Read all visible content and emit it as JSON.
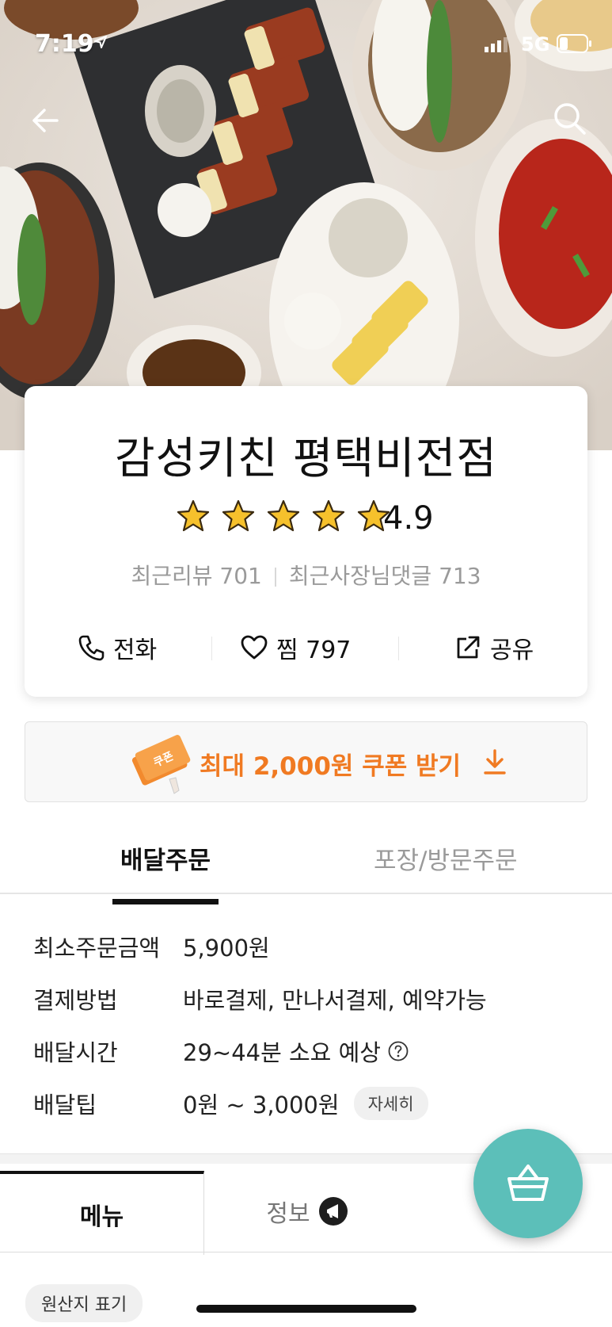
{
  "status_bar": {
    "time": "7:19",
    "network": "5G"
  },
  "store": {
    "name": "감성키친 평택비전점",
    "rating": "4.9",
    "stars_filled": 5,
    "recent_reviews": "최근리뷰 701",
    "owner_replies": "최근사장님댓글 713"
  },
  "actions": {
    "call": "전화",
    "favorite": "찜 797",
    "share": "공유"
  },
  "coupon": {
    "label": "최대 2,000원 쿠폰 받기",
    "ticket_text": "쿠폰"
  },
  "order_tabs": {
    "delivery": "배달주문",
    "pickup": "포장/방문주문"
  },
  "info": {
    "min_order_key": "최소주문금액",
    "min_order_val": "5,900원",
    "payment_key": "결제방법",
    "payment_val": "바로결제, 만나서결제, 예약가능",
    "time_key": "배달시간",
    "time_val": "29~44분 소요 예상",
    "tip_key": "배달팁",
    "tip_val": "0원 ~ 3,000원",
    "tip_detail": "자세히"
  },
  "bottom_tabs": {
    "menu": "메뉴",
    "info": "정보"
  },
  "origin_chip": "원산지 표기",
  "colors": {
    "accent_orange": "#f07a22",
    "cart_teal": "#5cbfb9",
    "star_gold": "#f6c12c"
  },
  "icons": [
    "back-arrow-icon",
    "search-icon",
    "star-icon",
    "phone-icon",
    "heart-icon",
    "share-icon",
    "download-arrow-icon",
    "help-icon",
    "megaphone-icon",
    "basket-icon"
  ]
}
